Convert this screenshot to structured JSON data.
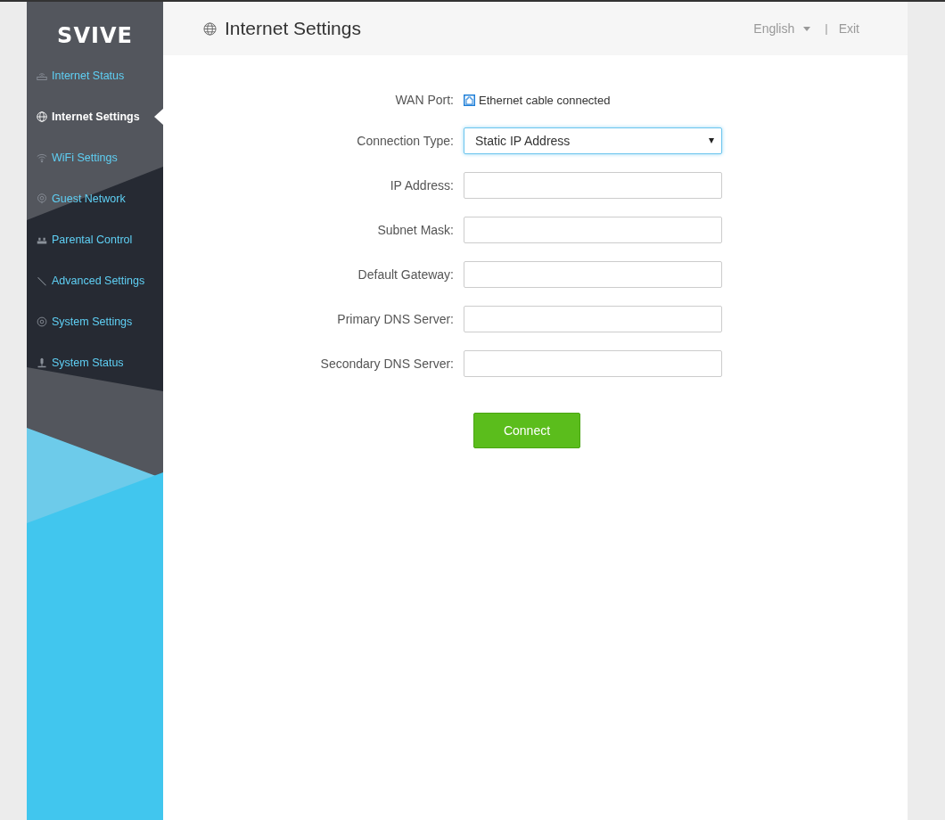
{
  "sidebar": {
    "logo": "SVIVE",
    "items": [
      {
        "label": "Internet Status",
        "selected": false
      },
      {
        "label": "Internet Settings",
        "selected": true
      },
      {
        "label": "WiFi Settings",
        "selected": false
      },
      {
        "label": "Guest Network",
        "selected": false
      },
      {
        "label": "Parental Control",
        "selected": false
      },
      {
        "label": "Advanced Settings",
        "selected": false
      },
      {
        "label": "System Settings",
        "selected": false
      },
      {
        "label": "System Status",
        "selected": false
      }
    ]
  },
  "header": {
    "title": "Internet Settings",
    "language": "English",
    "separator": "|",
    "exit": "Exit"
  },
  "form": {
    "fields": [
      {
        "kind": "status",
        "label": "WAN Port:",
        "value": "Ethernet cable connected"
      },
      {
        "kind": "select",
        "label": "Connection Type:",
        "value": "Static IP Address"
      },
      {
        "kind": "text",
        "label": "IP Address:"
      },
      {
        "kind": "text",
        "label": "Subnet Mask:"
      },
      {
        "kind": "text",
        "label": "Default Gateway:"
      },
      {
        "kind": "text",
        "label": "Primary DNS Server:"
      },
      {
        "kind": "text",
        "label": "Secondary DNS Server:"
      }
    ],
    "button": "Connect"
  }
}
